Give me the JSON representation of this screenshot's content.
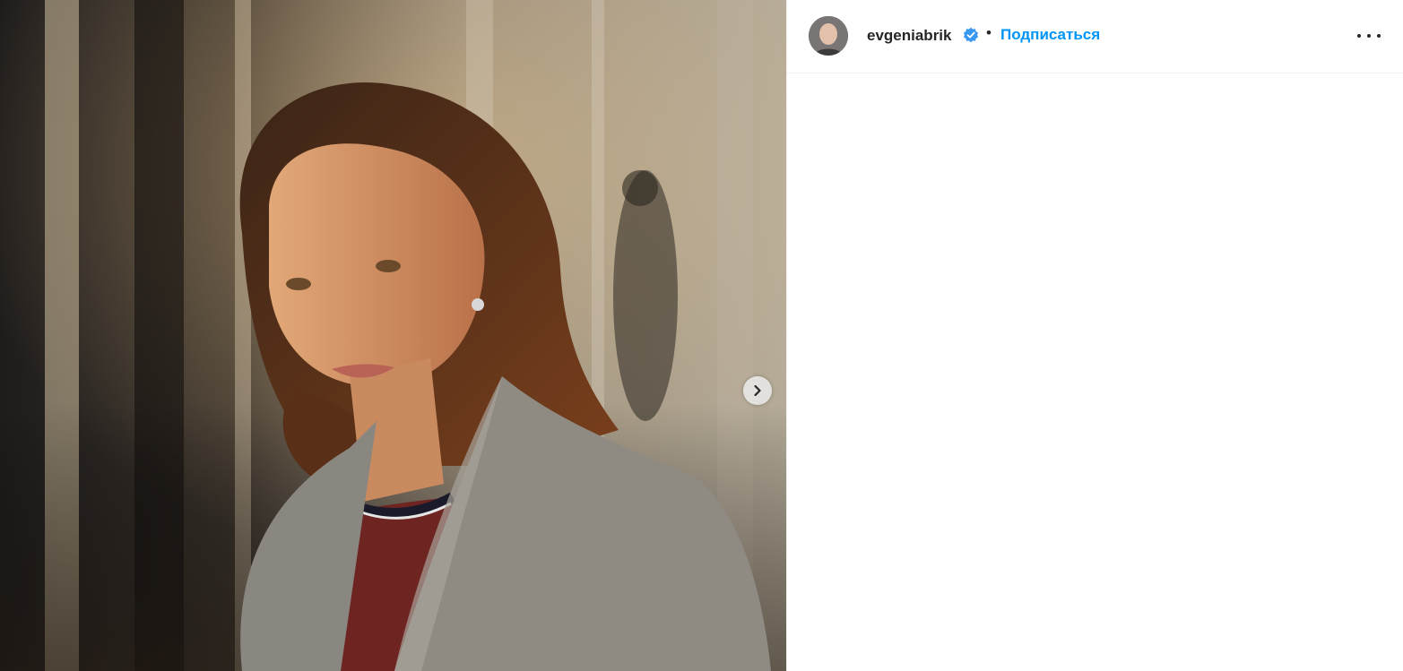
{
  "post": {
    "author": {
      "username": "evgeniabrik",
      "verified": true,
      "follow_label": "Подписаться",
      "separator": "•"
    },
    "media": {
      "type": "photo-carousel",
      "has_next": true
    }
  },
  "icons": {
    "verified": "verified-badge-icon",
    "more": "more-options-icon",
    "next": "chevron-right-icon"
  },
  "colors": {
    "link": "#0095f6",
    "verified": "#3897f0",
    "text": "#262626"
  }
}
